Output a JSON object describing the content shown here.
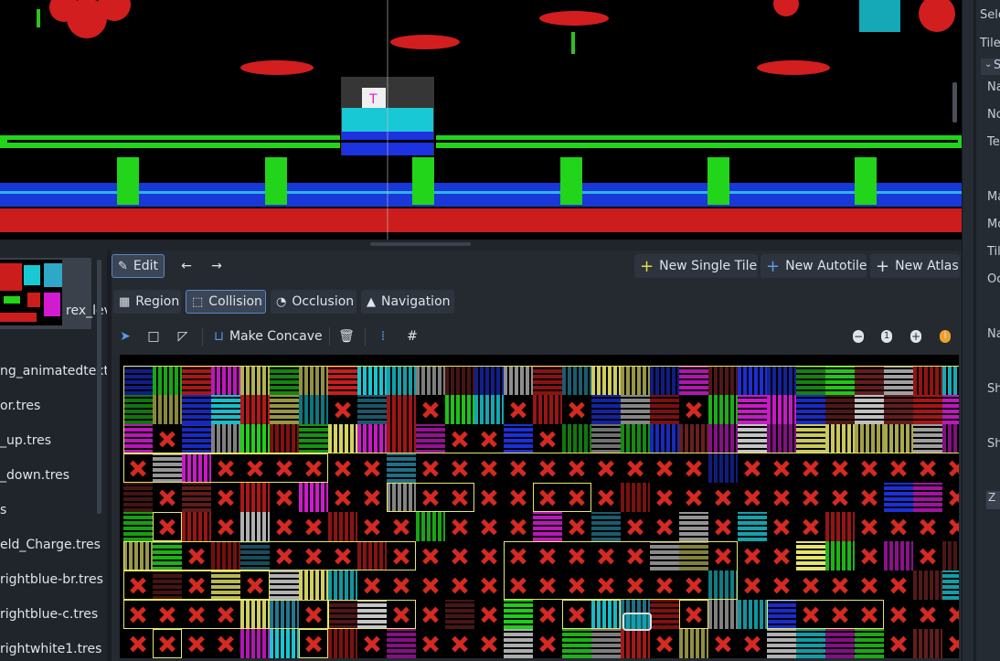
{
  "inspector": {
    "rows": [
      {
        "label": "Sele"
      },
      {
        "label": "Tile"
      },
      {
        "label": "S"
      },
      {
        "label": "Na"
      },
      {
        "label": "No"
      },
      {
        "label": "Te"
      },
      {
        "label": "Ma"
      },
      {
        "label": "Mo"
      },
      {
        "label": "Til"
      },
      {
        "label": "Oc"
      },
      {
        "label": "Na"
      },
      {
        "label": "Sh"
      },
      {
        "label": "Sh"
      },
      {
        "label": "Z I"
      }
    ]
  },
  "filesystem": {
    "thumb_label": "rex_lev",
    "items": [
      "ng_animatedtextu",
      "or.tres",
      "_up.tres",
      "_down.tres",
      "s",
      "eld_Charge.tres",
      "rightblue-br.tres",
      "rightblue-c.tres",
      "rightwhite1.tres"
    ]
  },
  "toolbar": {
    "edit_label": "Edit",
    "back_icon": "arrow-left-icon",
    "forward_icon": "arrow-right-icon",
    "new_single_tile": "New Single Tile",
    "new_autotile": "New Autotile",
    "new_atlas": "New Atlas"
  },
  "tabs": [
    {
      "label": "Region",
      "active": false
    },
    {
      "label": "Collision",
      "active": true
    },
    {
      "label": "Occlusion",
      "active": false
    },
    {
      "label": "Navigation",
      "active": false
    }
  ],
  "tools": {
    "make_concave": "Make Concave"
  },
  "zoom": {
    "reset_label": "1"
  },
  "colors": {
    "accent": "#5b86c7",
    "grid_border": "#e8e66a",
    "x_mark": "#d52a22"
  }
}
